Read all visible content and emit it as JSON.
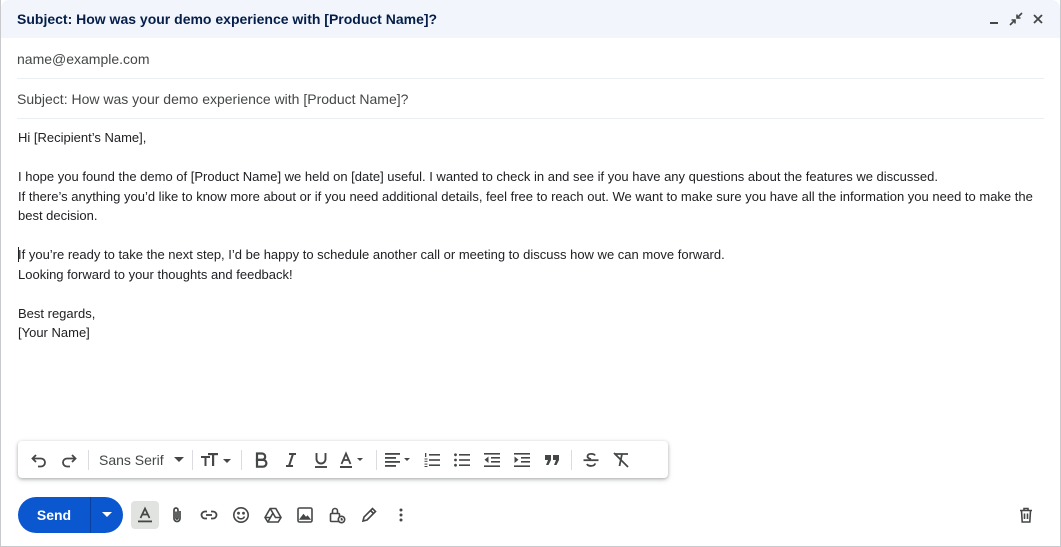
{
  "window": {
    "title": "Subject: How was your demo experience with [Product Name]?"
  },
  "recipients": {
    "to": "name@example.com"
  },
  "subject": {
    "value": "Subject: How was your demo experience with [Product Name]?"
  },
  "body": {
    "lines": [
      "Hi [Recipient’s Name],",
      "",
      "I hope you found the demo of [Product Name] we held on [date] useful. I wanted to check in and see if you have any questions about the features we discussed.",
      "If there’s anything you’d like to know more about or if you need additional details, feel free to reach out. We want to make sure you have all the information you need to make the best decision.",
      "",
      "If you’re ready to take the next step, I’d be happy to schedule another call or meeting to discuss how we can move forward.",
      "Looking forward to your thoughts and feedback!",
      "",
      "Best regards,",
      "[Your Name]"
    ]
  },
  "format_bar": {
    "font": "Sans Serif"
  },
  "actions": {
    "send_label": "Send"
  },
  "colors": {
    "accent": "#0b57d0",
    "titlebar_bg": "#f2f6fc"
  }
}
